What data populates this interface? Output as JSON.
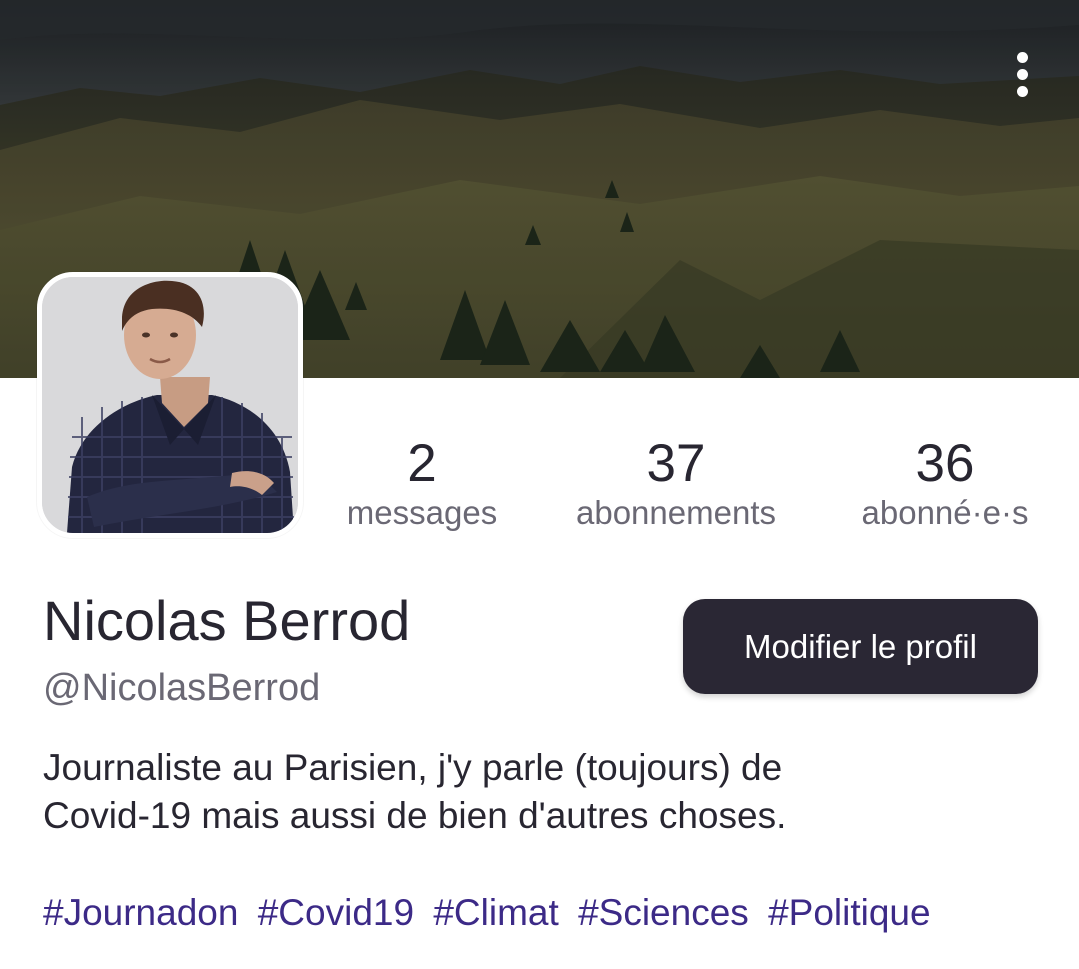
{
  "header": {
    "menu_icon": "more-vertical-icon"
  },
  "profile": {
    "avatar_icon": "profile-photo",
    "display_name": "Nicolas Berrod",
    "handle": "@NicolasBerrod",
    "edit_button_label": "Modifier le profil",
    "bio_lines": [
      "Journaliste au Parisien, j'y parle (toujours) de",
      "Covid-19 mais aussi de bien d'autres choses."
    ],
    "hashtags": [
      "#Journadon",
      "#Covid19",
      "#Climat",
      "#Sciences",
      "#Politique"
    ]
  },
  "stats": {
    "messages": {
      "value": "2",
      "label": "messages"
    },
    "following": {
      "value": "37",
      "label": "abonnements"
    },
    "followers": {
      "value": "36",
      "label": "abonné·e·s"
    }
  },
  "colors": {
    "text_primary": "#282631",
    "text_secondary": "#6a6874",
    "button_bg": "#2a2734",
    "hashtag": "#3c2a87"
  }
}
